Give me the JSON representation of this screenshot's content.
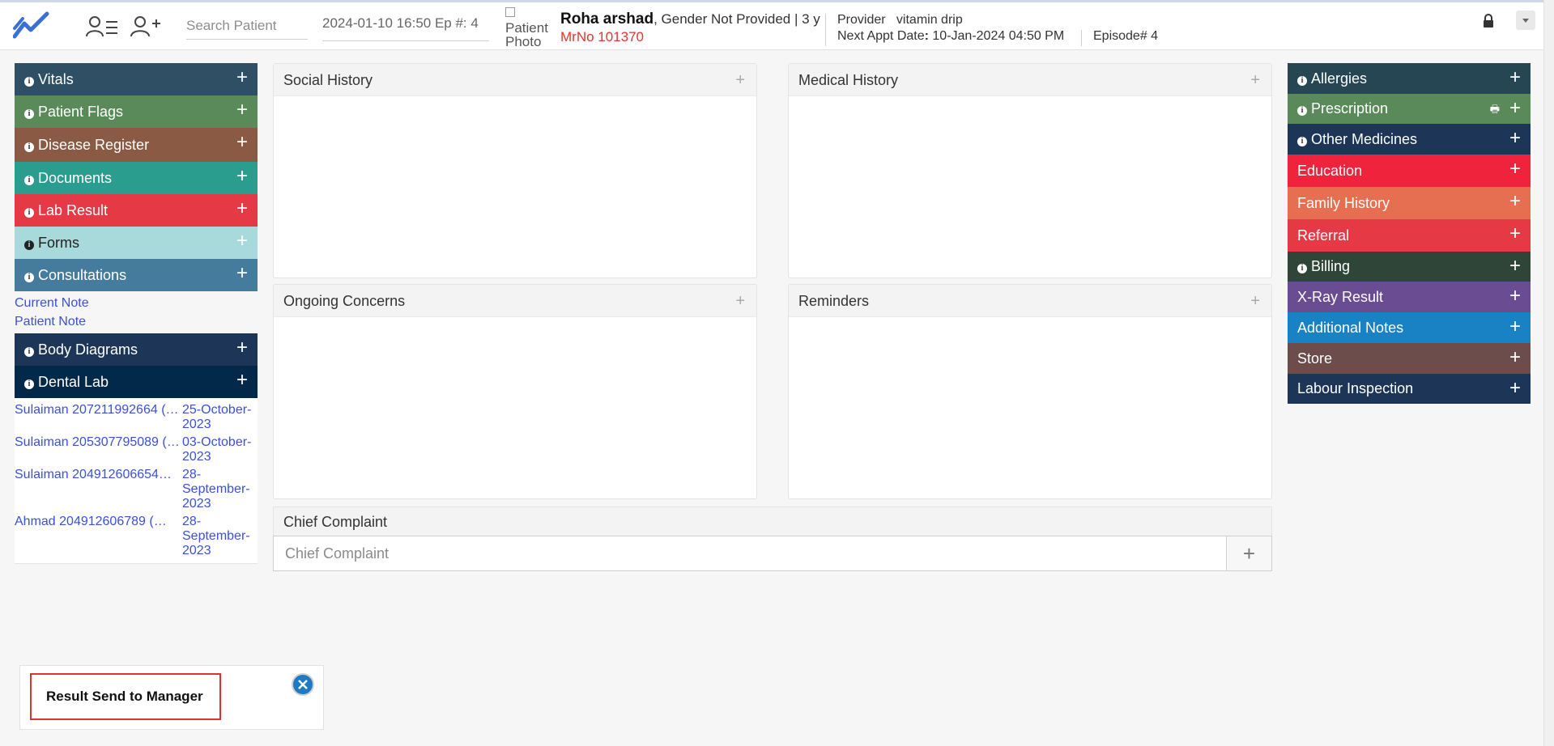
{
  "header": {
    "search_placeholder": "Search Patient",
    "episode_select": "2024-01-10 16:50 Ep #: 4",
    "photo_alt": "Patient Photo",
    "patient_name": "Roha arshad",
    "patient_info": ", Gender Not Provided | 3 y",
    "mrno": "MrNo 101370",
    "provider_label": "Provider",
    "provider_value": "vitamin drip",
    "appt_label": "Next Appt Date",
    "appt_value": "10-Jan-2024 04:50 PM",
    "episode_no": "Episode# 4",
    "icons": [
      "app-logo-icon",
      "patient-list-icon",
      "add-patient-icon",
      "lock-icon",
      "dropdown-caret-icon"
    ]
  },
  "left_menu": [
    {
      "label": "Vitals",
      "info": true,
      "color": "#2f5064"
    },
    {
      "label": "Patient Flags",
      "info": true,
      "color": "#5a8a5a"
    },
    {
      "label": "Disease Register",
      "info": true,
      "color": "#8a5a44"
    },
    {
      "label": "Documents",
      "info": true,
      "color": "#2a9d8f"
    },
    {
      "label": "Lab Result",
      "info": true,
      "color": "#e63946"
    },
    {
      "label": "Forms",
      "info": true,
      "color": "#a8dadc"
    },
    {
      "label": "Consultations",
      "info": true,
      "color": "#457b9d"
    }
  ],
  "note_links": [
    "Current Note",
    "Patient Note"
  ],
  "left_menu2": [
    {
      "label": "Body Diagrams",
      "info": true,
      "color": "#1d3557"
    },
    {
      "label": "Dental Lab",
      "info": true,
      "color": "#03294a"
    }
  ],
  "lab_entries": [
    {
      "name": "Sulaiman 207211992664 (…",
      "date": "25-October-2023"
    },
    {
      "name": "Sulaiman 205307795089 (…",
      "date": "03-October-2023"
    },
    {
      "name": "Sulaiman 204912606654…",
      "date": "28-September-2023"
    },
    {
      "name": "Ahmad 204912606789 (…",
      "date": "28-September-2023"
    }
  ],
  "panels": {
    "social_history": "Social History",
    "medical_history": "Medical History",
    "ongoing_concerns": "Ongoing Concerns",
    "reminders": "Reminders"
  },
  "chief_complaint": {
    "title": "Chief Complaint",
    "placeholder": "Chief Complaint"
  },
  "right_menu": [
    {
      "label": "Allergies",
      "info": true,
      "color": "#264653"
    },
    {
      "label": "Prescription",
      "info": true,
      "color": "#5a8a5a",
      "print": true
    },
    {
      "label": "Other Medicines",
      "info": true,
      "color": "#1d3557"
    },
    {
      "label": "Education",
      "info": false,
      "color": "#ef233c"
    },
    {
      "label": "Family History",
      "info": false,
      "color": "#e76f51"
    },
    {
      "label": "Referral",
      "info": false,
      "color": "#e63946"
    },
    {
      "label": "Billing",
      "info": true,
      "color": "#2f4538"
    },
    {
      "label": "X-Ray Result",
      "info": false,
      "color": "#6a4c93"
    },
    {
      "label": "Additional Notes",
      "info": false,
      "color": "#1982c4"
    },
    {
      "label": "Store",
      "info": false,
      "color": "#6d4c4c"
    },
    {
      "label": "Labour Inspection",
      "info": false,
      "color": "#1d3557"
    }
  ],
  "toast": {
    "message": "Result Send to Manager"
  }
}
